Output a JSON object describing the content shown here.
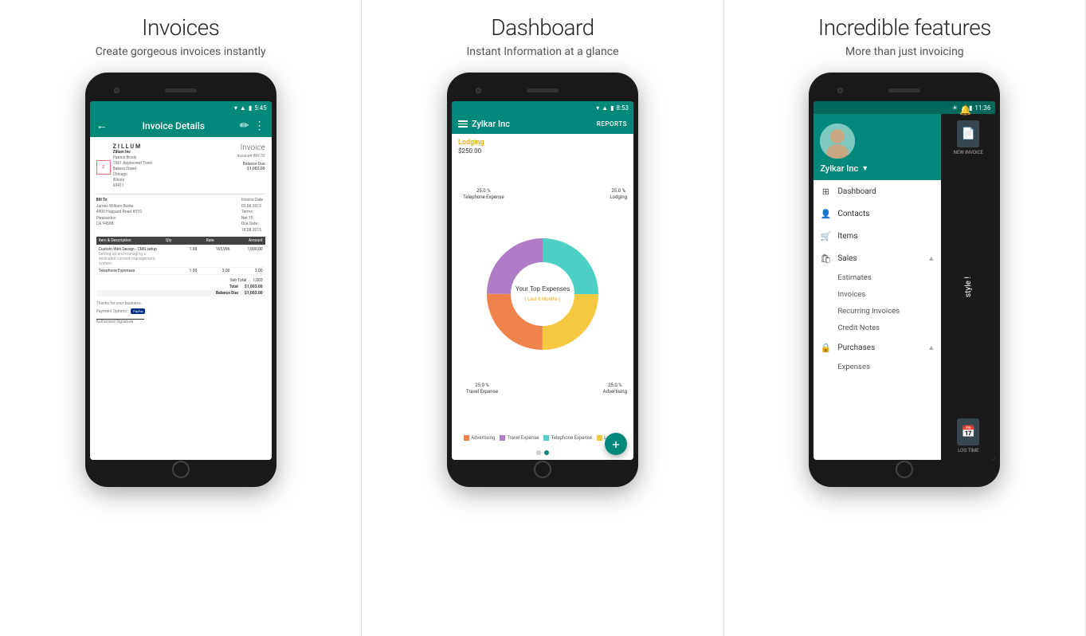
{
  "sections": [
    {
      "id": "invoices",
      "title": "Invoices",
      "subtitle": "Create gorgeous invoices instantly"
    },
    {
      "id": "dashboard",
      "title": "Dashboard",
      "subtitle": "Instant Information at a glance"
    },
    {
      "id": "features",
      "title": "Incredible features",
      "subtitle": "More than just invoicing"
    }
  ],
  "screen1": {
    "status_time": "5:45",
    "header_title": "Invoice Details",
    "company_logo_letter": "Z",
    "company_logo_name": "ILLUM",
    "company_name": "Zillum Inc",
    "company_contact": "Patrick Brody",
    "company_address1": "1561 Applecrest Town",
    "company_address2": "Bakers Street",
    "company_city": "Chicago",
    "company_state": "Illinois",
    "company_zip": "60411",
    "invoice_title": "Invoice",
    "invoice_number": "Invoice# INV-30",
    "balance_due_label": "Balance Due",
    "balance_due_amount": "$1,003.00",
    "bill_to_label": "Bill To",
    "bill_to_name": "James William Burke",
    "bill_to_address": "4900 Hoppard Road #310",
    "bill_to_city": "Pleasanton",
    "bill_to_state": "CA 94588",
    "invoice_date_label": "Invoice Date :",
    "invoice_date": "03.08.2015",
    "terms_label": "Terms :",
    "terms": "Net 15",
    "due_date_label": "Due Date :",
    "due_date": "18.08.2015",
    "table_columns": [
      "Item & Description",
      "Qty",
      "Rate",
      "Amount"
    ],
    "table_rows": [
      {
        "desc": "Custom Web Design - CMS setup",
        "desc_sub": "Setting up and managing a dedicated content management system.",
        "qty": "1.00",
        "rate": "165,996",
        "amount": "1,000.00"
      },
      {
        "desc": "Telephone Expenses",
        "qty": "1.00",
        "rate": "3.00",
        "amount": "3.00"
      }
    ],
    "sub_total_label": "Sub Total",
    "sub_total": "1,003",
    "total_label": "Total",
    "total": "$1,003.00",
    "balance_label": "Balance Due",
    "balance": "$1,003.00",
    "thanks_text": "Thanks for your business.",
    "payment_options_label": "Payment Options :",
    "signature_label": "Authorized Signature"
  },
  "screen2": {
    "status_time": "8:53",
    "app_name": "Zylkar Inc",
    "reports_btn": "REPORTS",
    "expense_category": "Lodging",
    "expense_amount": "$250.00",
    "chart_center_line1": "Your Top Expenses",
    "chart_center_line2": "( Last 6 Months )",
    "segments": [
      {
        "label": "25.0 %\nTelephone Expense",
        "color": "#4dd0c4",
        "percent": 25
      },
      {
        "label": "25.0 %\nLodging",
        "color": "#f5c842",
        "percent": 25
      },
      {
        "label": "25.0 %\nAdvertising",
        "color": "#f0834b",
        "percent": 25
      },
      {
        "label": "25.0 %\nTravel Expense",
        "color": "#b07cc6",
        "percent": 25
      }
    ],
    "legend": [
      {
        "label": "Advertising",
        "color": "#f0834b"
      },
      {
        "label": "Travel Expense",
        "color": "#b07cc6"
      },
      {
        "label": "Telephone Expense",
        "color": "#4dd0c4"
      },
      {
        "label": "Lodging",
        "color": "#f5c842"
      }
    ],
    "fab_icon": "+",
    "dots": [
      false,
      true
    ]
  },
  "screen3": {
    "status_time": "11:36",
    "bell_icon": "🔔",
    "company_name": "Zylkar Inc",
    "nav_items": [
      {
        "label": "Dashboard",
        "icon": "⊞"
      },
      {
        "label": "Contacts",
        "icon": "👤"
      },
      {
        "label": "Items",
        "icon": "🛒"
      },
      {
        "label": "Sales",
        "icon": "🛍",
        "has_arrow": true,
        "expanded": true
      }
    ],
    "sales_subitems": [
      "Estimates",
      "Invoices",
      "Recurring Invoices",
      "Credit Notes"
    ],
    "purchases_label": "Purchases",
    "purchases_has_arrow": true,
    "expenses_label": "Expenses",
    "right_panel_new_invoice": "NEW INVOICE",
    "right_panel_log_time": "LOG TIME",
    "tagline": "style !"
  }
}
